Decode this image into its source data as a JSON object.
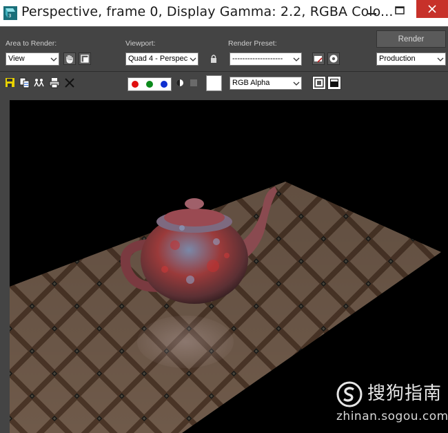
{
  "window": {
    "title": "Perspective, frame 0, Display Gamma: 2.2, RGBA Colo...",
    "minimize_glyph": "—",
    "maximize_glyph": "☐",
    "close_glyph": "✕"
  },
  "toolbar": {
    "area_to_render": {
      "label": "Area to Render:",
      "value": "View"
    },
    "viewport": {
      "label": "Viewport:",
      "value": "Quad 4 - Perspec"
    },
    "render_preset": {
      "label": "Render Preset:",
      "value": "--------------------"
    },
    "render_button": "Render",
    "production": {
      "value": "Production"
    },
    "channel": {
      "value": "RGB Alpha"
    }
  },
  "colors": {
    "panel_bg": "#444444",
    "red_channel": "#e01010",
    "green_channel": "#0c8a1c",
    "blue_channel": "#1030d0",
    "close_button": "#c7312a"
  },
  "icons": [
    "app-3dsmax-icon",
    "hand-icon",
    "region-icon",
    "lock-icon",
    "preset-save-icon",
    "preset-settings-icon",
    "save-image-icon",
    "copy-image-icon",
    "clone-window-icon",
    "print-icon",
    "clear-icon",
    "mono-icon",
    "display-alpha-icon",
    "toggle-ui-overlay-icon",
    "toggle-ui-icon"
  ],
  "watermark": {
    "brand": "搜狗指南",
    "url": "zhinan.sogou.com"
  }
}
